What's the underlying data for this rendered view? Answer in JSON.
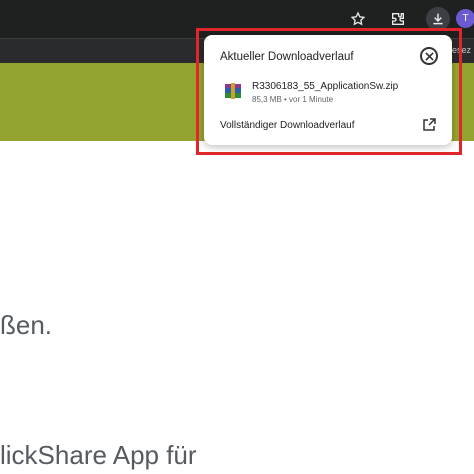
{
  "browser": {
    "profile_initial": "T",
    "bookmarks_bar_partial_label": "Lesez"
  },
  "page": {
    "line1": "ßen.",
    "line2": "lickShare App für",
    "banner_color": "#94a330"
  },
  "download_popup": {
    "title": "Aktueller Downloadverlauf",
    "item": {
      "filename": "R3306183_55_ApplicationSw.zip",
      "meta": "85,3 MB • vor 1 Minute"
    },
    "full_history_label": "Vollständiger Downloadverlauf"
  },
  "annotation": {
    "highlight_color": "#e0262b"
  },
  "icons": [
    "star-icon",
    "extensions-icon",
    "download-icon",
    "close-icon",
    "archive-file-icon",
    "open-external-icon"
  ]
}
